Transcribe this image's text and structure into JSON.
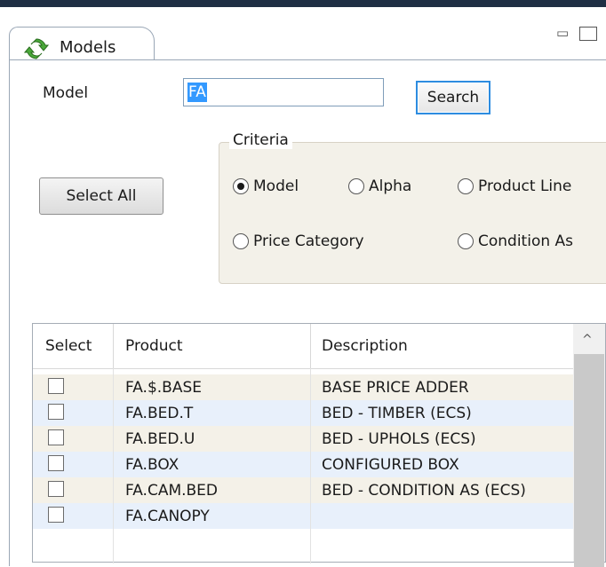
{
  "window": {
    "tab_title": "Models",
    "minimize_icon": "minimize-icon",
    "maximize_icon": "maximize-icon"
  },
  "form": {
    "model_label": "Model",
    "model_value": "FA",
    "search_label": "Search",
    "select_all_label": "Select All"
  },
  "criteria": {
    "title": "Criteria",
    "options": [
      {
        "label": "Model",
        "selected": true
      },
      {
        "label": "Alpha",
        "selected": false
      },
      {
        "label": "Product Line",
        "selected": false
      },
      {
        "label": "Price Category",
        "selected": false
      },
      {
        "label": "Condition As",
        "selected": false
      }
    ]
  },
  "table": {
    "columns": [
      "Select",
      "Product",
      "Description"
    ],
    "rows": [
      {
        "product": "FA.$.BASE",
        "description": "BASE PRICE ADDER",
        "checked": false
      },
      {
        "product": "FA.BED.T",
        "description": "BED - TIMBER (ECS)",
        "checked": false
      },
      {
        "product": "FA.BED.U",
        "description": "BED - UPHOLS (ECS)",
        "checked": false
      },
      {
        "product": "FA.BOX",
        "description": "CONFIGURED BOX",
        "checked": false
      },
      {
        "product": "FA.CAM.BED",
        "description": "BED - CONDITION AS (ECS)",
        "checked": false
      },
      {
        "product": "FA.CANOPY",
        "description": "",
        "checked": false
      }
    ],
    "row_colors": [
      "#f4f1e8",
      "#e8f0fb"
    ]
  },
  "colors": {
    "accent": "#2d8ce0",
    "selection": "#3399ff",
    "criteria_bg": "#f3f1e9"
  }
}
